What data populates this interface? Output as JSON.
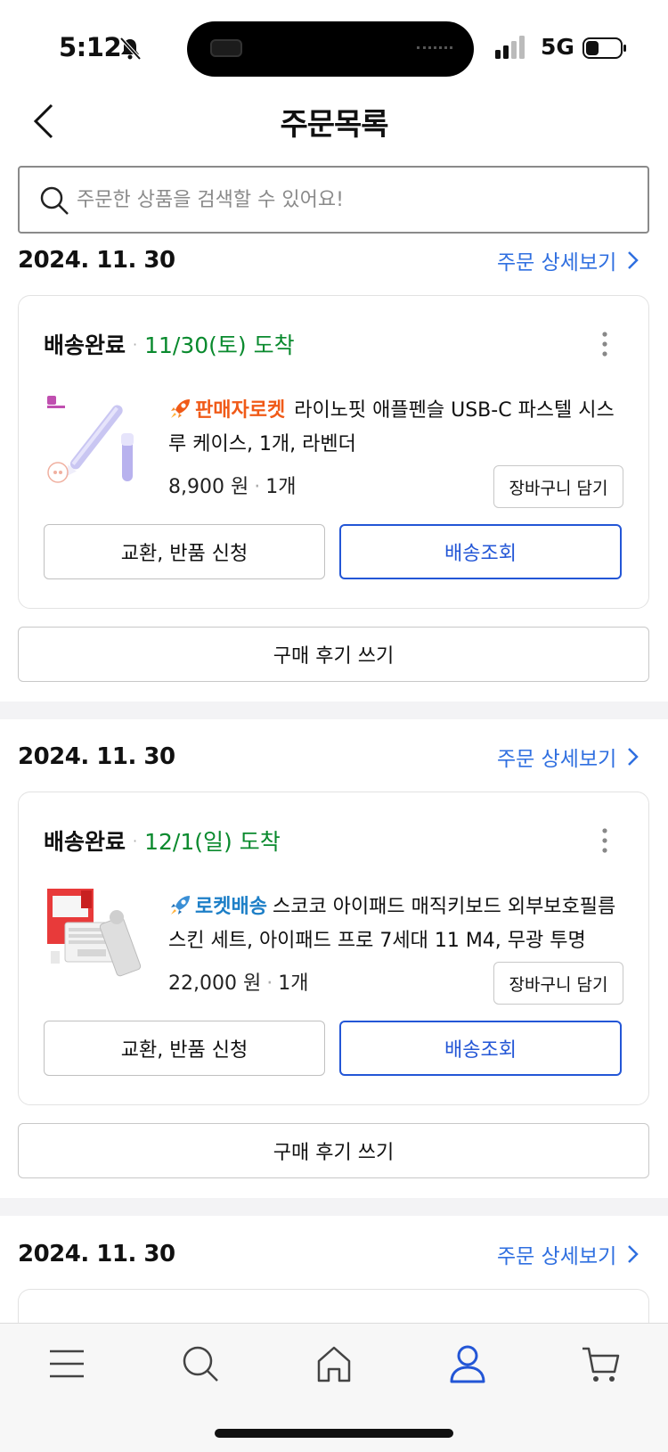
{
  "status_bar": {
    "time": "5:12",
    "network": "5G"
  },
  "header": {
    "title": "주문목록"
  },
  "search": {
    "placeholder": "주문한 상품을 검색할 수 있어요!"
  },
  "orders": [
    {
      "date": "2024. 11. 30",
      "detail_link": "주문 상세보기",
      "status": "배송완료",
      "arrival": "11/30(토) 도착",
      "tag": "판매자로켓",
      "product_name": "라이노핏 애플펜슬 USB-C 파스텔 시스루 케이스, 1개, 라벤더",
      "price": "8,900 원",
      "qty": "1개",
      "cart_label": "장바구니 담기",
      "exchange_label": "교환, 반품 신청",
      "track_label": "배송조회",
      "review_label": "구매 후기 쓰기"
    },
    {
      "date": "2024. 11. 30",
      "detail_link": "주문 상세보기",
      "status": "배송완료",
      "arrival": "12/1(일) 도착",
      "tag": "로켓배송",
      "product_name": "스코코 아이패드 매직키보드 외부보호필름 스킨 세트, 아이패드 프로 7세대 11 M4, 무광 투명",
      "price": "22,000 원",
      "qty": "1개",
      "cart_label": "장바구니 담기",
      "exchange_label": "교환, 반품 신청",
      "track_label": "배송조회",
      "review_label": "구매 후기 쓰기"
    },
    {
      "date": "2024. 11. 30",
      "detail_link": "주문 상세보기"
    }
  ],
  "colors": {
    "link_blue": "#2f6fe0",
    "track_blue": "#2356d6",
    "arrival_green": "#0a8a2e",
    "seller_rocket_orange": "#f05a18",
    "rocket_delivery_blue": "#1d7fc7",
    "nav_active": "#2356d6"
  },
  "bottom_nav": {
    "items": [
      "menu-icon",
      "search-icon",
      "home-icon",
      "my-page-icon",
      "cart-icon"
    ],
    "active": "my-page-icon"
  }
}
